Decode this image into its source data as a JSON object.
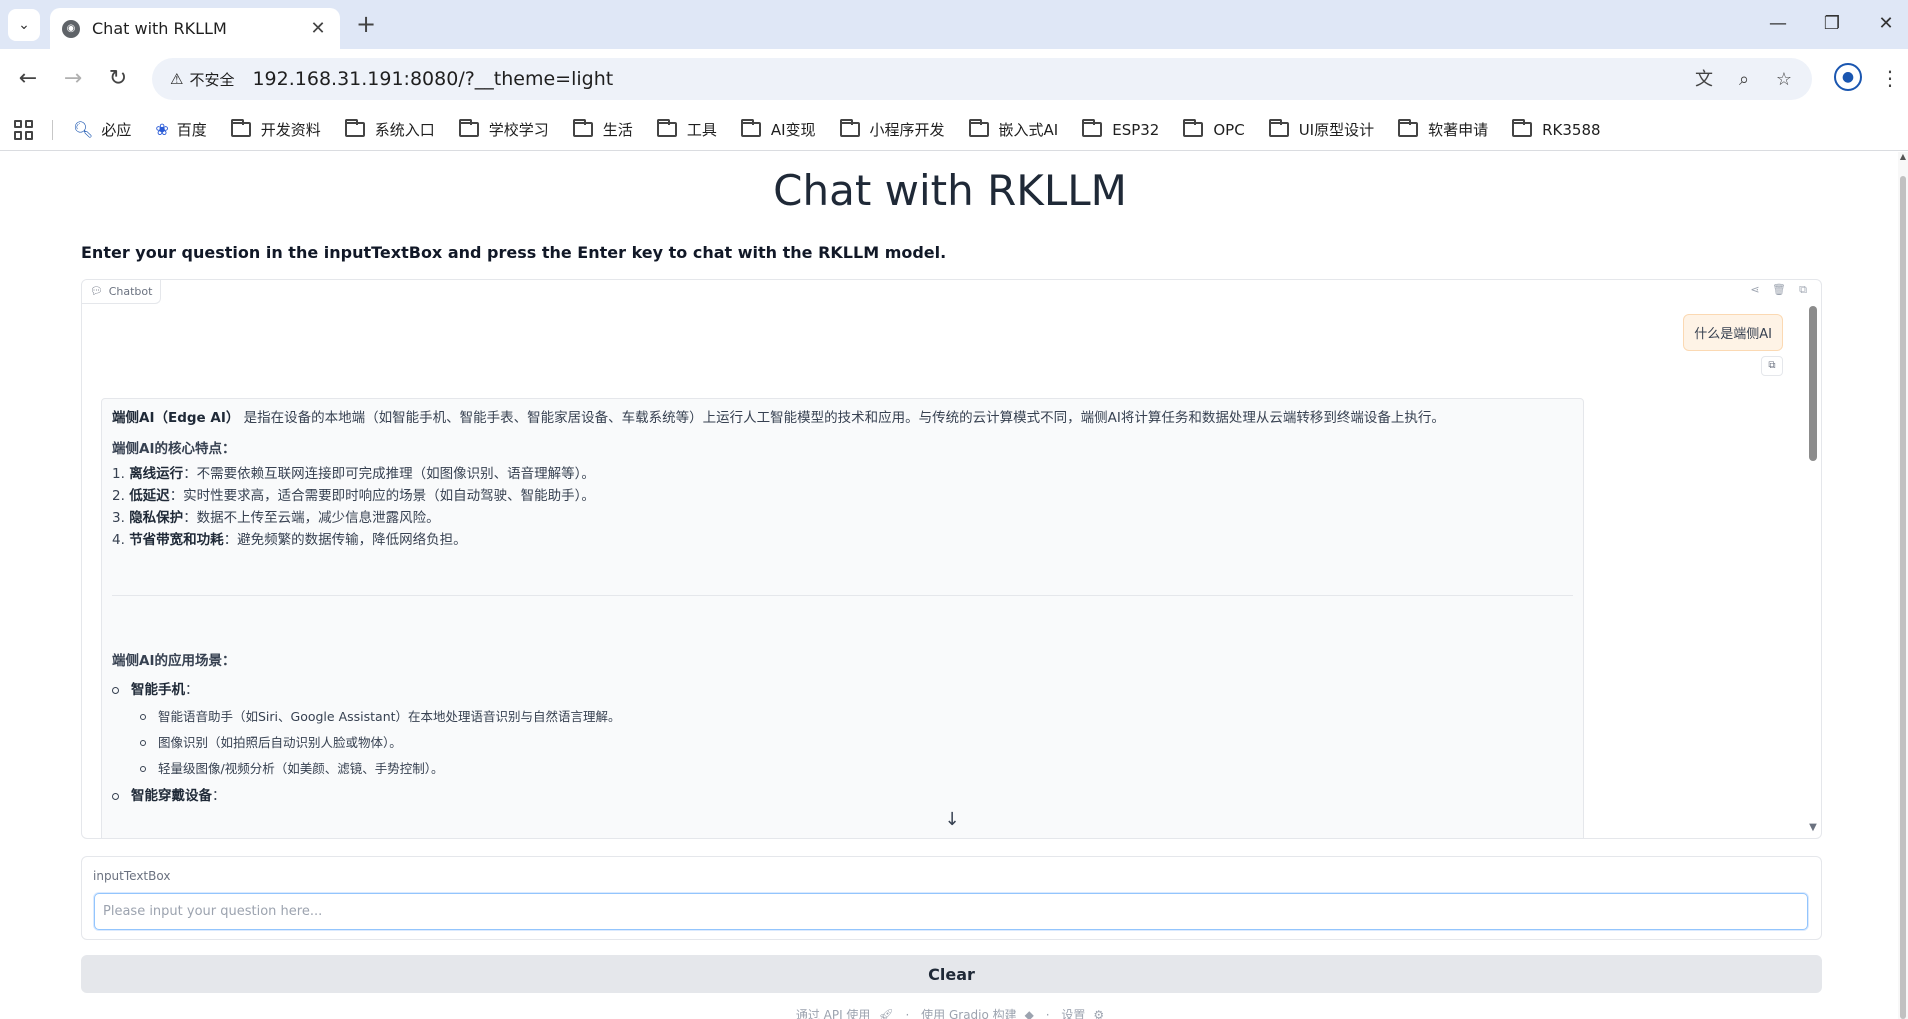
{
  "browser": {
    "tab_title": "Chat with RKLLM",
    "security_label": "不安全",
    "url": "192.168.31.191:8080/?__theme=light",
    "bookmarks": [
      {
        "label": "必应",
        "icon": "search-icon"
      },
      {
        "label": "百度",
        "icon": "baidu-paw-icon"
      },
      {
        "label": "开发资料",
        "icon": "folder-icon"
      },
      {
        "label": "系统入口",
        "icon": "folder-icon"
      },
      {
        "label": "学校学习",
        "icon": "folder-icon"
      },
      {
        "label": "生活",
        "icon": "folder-icon"
      },
      {
        "label": "工具",
        "icon": "folder-icon"
      },
      {
        "label": "AI变现",
        "icon": "folder-icon"
      },
      {
        "label": "小程序开发",
        "icon": "folder-icon"
      },
      {
        "label": "嵌入式AI",
        "icon": "folder-icon"
      },
      {
        "label": "ESP32",
        "icon": "folder-icon"
      },
      {
        "label": "OPC",
        "icon": "folder-icon"
      },
      {
        "label": "UI原型设计",
        "icon": "folder-icon"
      },
      {
        "label": "软著申请",
        "icon": "folder-icon"
      },
      {
        "label": "RK3588",
        "icon": "folder-icon"
      }
    ]
  },
  "app": {
    "title": "Chat with RKLLM",
    "description": "Enter your question in the inputTextBox and press the Enter key to chat with the RKLLM model."
  },
  "chatbot": {
    "label": "Chatbot",
    "user_message": "什么是端侧AI",
    "bot": {
      "intro_bold": "端侧AI（Edge AI）",
      "intro_rest": "是指在设备的本地端（如智能手机、智能手表、智能家居设备、车载系统等）上运行人工智能模型的技术和应用。与传统的云计算模式不同，端侧AI将计算任务和数据处理从云端转移到终端设备上执行。",
      "features_heading": "端侧AI的核心特点：",
      "features": [
        {
          "num": "1.",
          "bold": "离线运行",
          "rest": "：不需要依赖互联网连接即可完成推理（如图像识别、语音理解等）。"
        },
        {
          "num": "2.",
          "bold": "低延迟",
          "rest": "：实时性要求高，适合需要即时响应的场景（如自动驾驶、智能助手）。"
        },
        {
          "num": "3.",
          "bold": "隐私保护",
          "rest": "：数据不上传至云端，减少信息泄露风险。"
        },
        {
          "num": "4.",
          "bold": "节省带宽和功耗",
          "rest": "：避免频繁的数据传输，降低网络负担。"
        }
      ],
      "scenes_heading": "端侧AI的应用场景：",
      "scene1": "智能手机",
      "scene1_colon": "：",
      "scene1_items": [
        "智能语音助手（如Siri、Google Assistant）在本地处理语音识别与自然语言理解。",
        "图像识别（如拍照后自动识别人脸或物体）。",
        "轻量级图像/视频分析（如美颜、滤镜、手势控制）。"
      ],
      "scene2": "智能穿戴设备",
      "scene2_colon": "："
    }
  },
  "input": {
    "label": "inputTextBox",
    "placeholder": "Please input your question here..."
  },
  "clear_label": "Clear",
  "footer": {
    "api": "通过 API 使用",
    "built": "使用 Gradio 构建",
    "settings": "设置",
    "sep": "·"
  }
}
